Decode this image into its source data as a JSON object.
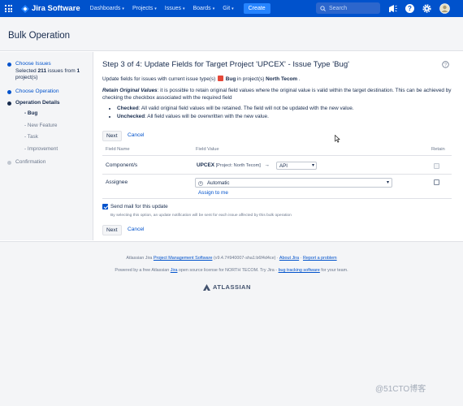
{
  "nav": {
    "app_name": "Jira Software",
    "items": [
      {
        "label": "Dashboards"
      },
      {
        "label": "Projects"
      },
      {
        "label": "Issues"
      },
      {
        "label": "Boards"
      },
      {
        "label": "Git"
      }
    ],
    "create_label": "Create",
    "search_placeholder": "Search"
  },
  "page": {
    "title": "Bulk Operation"
  },
  "sidebar": {
    "choose_issues": "Choose Issues",
    "selected_prefix": "Selected ",
    "selected_count": "211",
    "selected_middle": " issues from ",
    "project_count": "1",
    "selected_suffix": " project(s)",
    "choose_operation": "Choose Operation",
    "operation_details": "Operation Details",
    "subitems": [
      "- Bug",
      "- New Feature",
      "- Task",
      "- Improvement"
    ],
    "confirmation": "Confirmation"
  },
  "main": {
    "heading": "Step 3 of 4: Update Fields for Target Project 'UPCEX' - Issue Type 'Bug'",
    "intro_prefix": "Update fields for issues with current issue type(s) ",
    "intro_type": "Bug",
    "intro_middle": " in project(s) ",
    "intro_project": "North Tecom",
    "intro_suffix": " .",
    "retain_title": "Retain Original Values",
    "retain_text": ": it is possible to retain original field values where the original value is valid within the target destination. This can be achieved by checking the checkbox associated with the required field",
    "checked_label": "Checked",
    "checked_text": ": All valid original field values will be retained. The field will not be updated with the new value.",
    "unchecked_label": "Unchecked",
    "unchecked_text": ": All field values will be overwritten with the new value.",
    "next_label": "Next",
    "cancel_label": "Cancel",
    "table": {
      "col_field_name": "Field Name",
      "col_field_value": "Field Value",
      "col_retain": "Retain",
      "row1_name": "Component/s",
      "row1_project_code": "UPCEX",
      "row1_project_open": " [Project: ",
      "row1_project_name": "North Tecom",
      "row1_project_close": "]",
      "row1_arrow": "→",
      "row1_value": "API",
      "row2_name": "Assignee",
      "row2_value": "Automatic",
      "row2_assign_me": "Assign to me"
    },
    "send_mail_label": "Send mail for this update",
    "send_mail_note": "By selecting this option, an update notification will be sent for each issue affected by this bulk operation"
  },
  "footer": {
    "line1_prefix": "Atlassian Jira ",
    "line1_link": "Project Management Software",
    "line1_version": " (v9.4.7#940007-sha1:b6f4d4ce)",
    "line1_sep": " · ",
    "about": "About Jira",
    "report": "Report a problem",
    "line2_prefix": "Powered by a free Atlassian ",
    "line2_jira": "Jira",
    "line2_middle": " open source license for NORTH TECOM. Try Jira - ",
    "line2_link": "bug tracking software",
    "line2_suffix": " for your team.",
    "brand": "ATLASSIAN"
  },
  "watermark": "@51CTO博客",
  "colors": {
    "nav_bg": "#0052cc",
    "link": "#0052cc",
    "create": "#2684ff",
    "bug": "#e5493a"
  }
}
